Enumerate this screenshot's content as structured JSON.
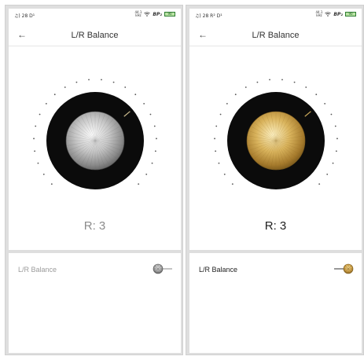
{
  "screens": [
    {
      "status": {
        "left": "♫) 28 D¹",
        "rate_top": "44.1",
        "rate_bottom": "kHz",
        "bp": "BP₂",
        "battery": "90"
      },
      "header": {
        "back_icon": "arrow-left-icon",
        "title": "L/R Balance"
      },
      "dial": {
        "knob_finish": "silver",
        "indicator_color": "#c9b98c"
      },
      "readout": "R: 3",
      "setting": {
        "label": "L/R Balance",
        "toggle_state": "off"
      }
    },
    {
      "status": {
        "left": "♫) 28 R² D¹",
        "rate_top": "44.1",
        "rate_bottom": "kHz",
        "bp": "BP₂",
        "battery": "90"
      },
      "header": {
        "back_icon": "arrow-left-icon",
        "title": "L/R Balance"
      },
      "dial": {
        "knob_finish": "gold",
        "indicator_color": "#c9a75a"
      },
      "readout": "R: 3",
      "setting": {
        "label": "L/R Balance",
        "toggle_state": "on"
      }
    }
  ],
  "colors": {
    "ring": "#0b0b0b",
    "tick": "#555555",
    "battery_fill": "#b9e3a4"
  }
}
